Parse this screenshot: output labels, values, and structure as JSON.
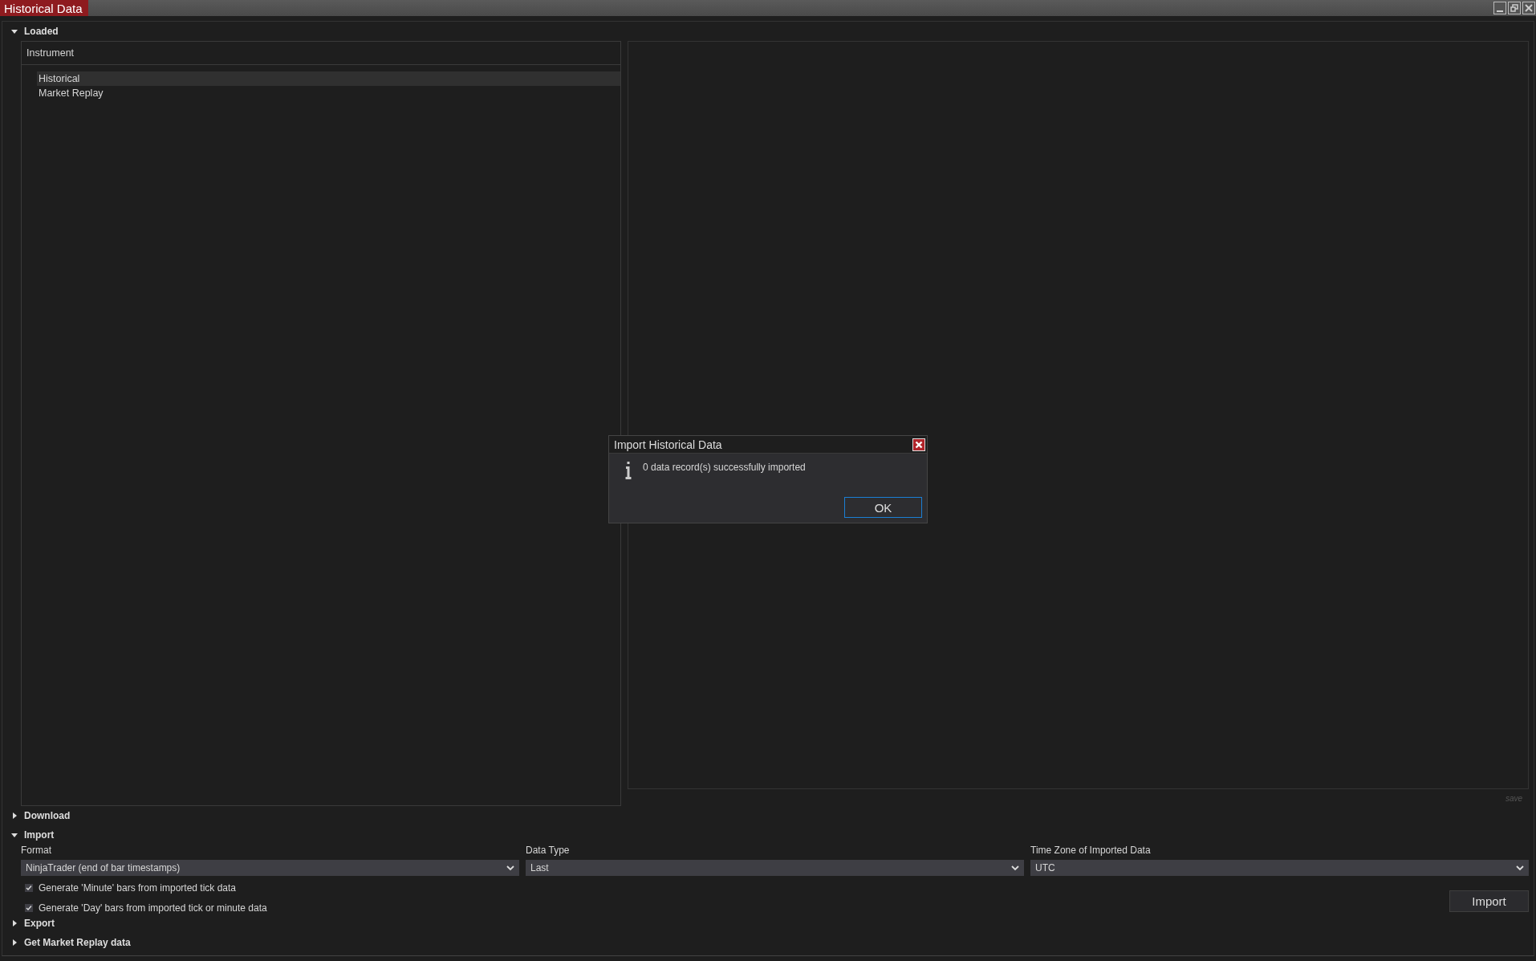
{
  "window": {
    "title": "Historical Data"
  },
  "loaded": {
    "label": "Loaded",
    "expanded": true,
    "list_header": "Instrument",
    "items": [
      {
        "label": "Historical",
        "selected": true
      },
      {
        "label": "Market Replay",
        "selected": false
      }
    ],
    "save_label": "save"
  },
  "download": {
    "label": "Download",
    "expanded": false
  },
  "import": {
    "label": "Import",
    "expanded": true,
    "fields": [
      {
        "label": "Format",
        "value": "NinjaTrader (end of bar timestamps)"
      },
      {
        "label": "Data Type",
        "value": "Last"
      },
      {
        "label": "Time Zone of Imported Data",
        "value": "UTC"
      }
    ],
    "checkboxes": [
      {
        "label": "Generate 'Minute' bars from imported tick data",
        "checked": true
      },
      {
        "label": "Generate 'Day' bars from imported tick or minute data",
        "checked": true
      }
    ],
    "button": "Import"
  },
  "export": {
    "label": "Export",
    "expanded": false
  },
  "market_replay": {
    "label": "Get Market Replay data",
    "expanded": false
  },
  "dialog": {
    "title": "Import Historical Data",
    "message": "0 data record(s) successfully imported",
    "button": "OK"
  }
}
